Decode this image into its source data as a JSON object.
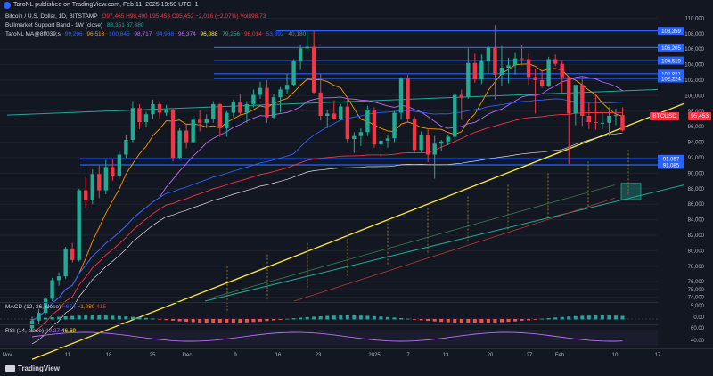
{
  "header": {
    "publisher": "TaroNL published on TradingView.com, Feb 11, 2025 19:50 UTC+1"
  },
  "legend": {
    "symbol_line": "Bitcoin / U.S. Dollar, 1D, BITSTAMP",
    "ohlc": "O97,465 H98,490 L95,453 C95,452 −2,016 (−2.07%) Vol898.73",
    "bull_band": "Bullmarket Support Band - 1W (close)",
    "bull_band_values": "88,351  87,380",
    "ma_line": "TaroNL MA@8ff039;s",
    "ma_values": [
      "99,296",
      "96,513",
      "100,845",
      "98,717",
      "94,938",
      "96,374",
      "96,088",
      "79,256",
      "98,014",
      "53,892",
      "40,180"
    ]
  },
  "macd_legend": {
    "label": "MACD (12, 26, close)",
    "values": [
      "−674",
      "−1,089",
      "415"
    ]
  },
  "rsi_legend": {
    "label": "RSI (14, close)",
    "values": [
      "40.27",
      "46.69"
    ]
  },
  "footer": {
    "logo_text": "TradingView"
  },
  "badges": {
    "last_price": "95,453",
    "symbol_tag": "BTCUSD"
  },
  "colors": {
    "background": "#131722",
    "up": "#22ab94",
    "down": "#f23645",
    "blue_level": "#2962ff",
    "trendline": "#ffeb3b",
    "channel": "#22ab94"
  },
  "chart_data": {
    "type": "candlestick",
    "x_ticks": [
      "Nov",
      "11",
      "18",
      "25",
      "Dec",
      "9",
      "16",
      "23",
      "2025",
      "7",
      "13",
      "20",
      "27",
      "Feb",
      "10",
      "17"
    ],
    "y_ticks": [
      110000,
      108000,
      106000,
      104000,
      102000,
      100000,
      98000,
      96000,
      94000,
      92000,
      90000,
      88000,
      86000,
      84000,
      82000,
      80000,
      78000,
      76000,
      75000,
      74000
    ],
    "y_tick_labels": [
      "110,000",
      "108,000",
      "106,000",
      "104,000",
      "102,000",
      "100,000",
      "98,000",
      "96,000",
      "94,000",
      "92,000",
      "90,000",
      "88,000",
      "86,000",
      "84,000",
      "82,000",
      "80,000",
      "78,000",
      "76,000",
      "75,000",
      "74,000"
    ],
    "horizontal_levels": [
      {
        "price": 108359,
        "label": "108,359"
      },
      {
        "price": 106205,
        "label": "106,205"
      },
      {
        "price": 104519,
        "label": "104,519"
      },
      {
        "price": 102821,
        "label": "102,821"
      },
      {
        "price": 102224,
        "label": "102,224"
      },
      {
        "price": 91857,
        "label": "91,857"
      },
      {
        "price": 91085,
        "label": "91,085"
      }
    ],
    "candles": [
      [
        70000,
        71500,
        69500,
        71000
      ],
      [
        71000,
        72500,
        70500,
        72000
      ],
      [
        72000,
        74000,
        71800,
        73800
      ],
      [
        73800,
        76500,
        73500,
        76200
      ],
      [
        76200,
        77200,
        75500,
        76700
      ],
      [
        76700,
        80500,
        76400,
        80300
      ],
      [
        80300,
        81000,
        78500,
        78800
      ],
      [
        78800,
        88000,
        78600,
        87800
      ],
      [
        87800,
        89500,
        85500,
        86500
      ],
      [
        86500,
        90500,
        86000,
        89900
      ],
      [
        89900,
        91000,
        86800,
        87800
      ],
      [
        87800,
        91700,
        87300,
        90800
      ],
      [
        90800,
        91800,
        89000,
        89700
      ],
      [
        89700,
        92800,
        89300,
        92400
      ],
      [
        92400,
        94900,
        92000,
        94300
      ],
      [
        94300,
        99300,
        94000,
        98400
      ],
      [
        98400,
        98900,
        95700,
        96600
      ],
      [
        96600,
        97900,
        96000,
        97600
      ],
      [
        97600,
        99500,
        97000,
        98900
      ],
      [
        98900,
        99300,
        97000,
        97800
      ],
      [
        97800,
        98800,
        97400,
        98100
      ],
      [
        98100,
        98300,
        91500,
        92000
      ],
      [
        92000,
        95800,
        91800,
        95500
      ],
      [
        95500,
        96400,
        93200,
        94000
      ],
      [
        94000,
        97400,
        93800,
        96900
      ],
      [
        96900,
        98100,
        95400,
        96500
      ],
      [
        96500,
        97600,
        95800,
        97000
      ],
      [
        97000,
        99300,
        96500,
        98900
      ],
      [
        98900,
        99000,
        94700,
        95800
      ],
      [
        95800,
        98000,
        94700,
        97800
      ],
      [
        97800,
        99500,
        97200,
        99200
      ],
      [
        99200,
        100300,
        97400,
        97800
      ],
      [
        97800,
        99300,
        96500,
        98900
      ],
      [
        98900,
        100800,
        98500,
        100100
      ],
      [
        100100,
        101800,
        99600,
        101000
      ],
      [
        101000,
        102000,
        96500,
        97200
      ],
      [
        97200,
        100200,
        96900,
        99800
      ],
      [
        99800,
        101100,
        97800,
        100800
      ],
      [
        100800,
        102800,
        100200,
        101400
      ],
      [
        101400,
        104700,
        101200,
        104400
      ],
      [
        104400,
        106500,
        103300,
        106100
      ],
      [
        106100,
        108300,
        105700,
        106300
      ],
      [
        106300,
        108400,
        100200,
        100400
      ],
      [
        100400,
        102800,
        96800,
        97400
      ],
      [
        97400,
        98200,
        95800,
        97700
      ],
      [
        97700,
        99400,
        96900,
        97000
      ],
      [
        97000,
        98900,
        96800,
        98600
      ],
      [
        98600,
        99800,
        94000,
        94400
      ],
      [
        94400,
        95300,
        92600,
        94800
      ],
      [
        94800,
        95800,
        93500,
        95300
      ],
      [
        95300,
        98700,
        94800,
        98200
      ],
      [
        98200,
        98500,
        93300,
        93700
      ],
      [
        93700,
        95000,
        92200,
        94200
      ],
      [
        94200,
        95000,
        93300,
        94500
      ],
      [
        94500,
        98000,
        94000,
        97800
      ],
      [
        97800,
        102400,
        96900,
        102200
      ],
      [
        102200,
        102700,
        96500,
        97000
      ],
      [
        97000,
        97300,
        92600,
        93000
      ],
      [
        93000,
        95400,
        92700,
        94900
      ],
      [
        94900,
        95700,
        91400,
        92400
      ],
      [
        92400,
        94800,
        89300,
        93800
      ],
      [
        93800,
        94300,
        92800,
        94100
      ],
      [
        94100,
        95000,
        93600,
        94700
      ],
      [
        94700,
        100300,
        94400,
        100100
      ],
      [
        100100,
        100800,
        96900,
        99800
      ],
      [
        99800,
        106100,
        99600,
        104200
      ],
      [
        104200,
        105400,
        101700,
        102100
      ],
      [
        102100,
        105300,
        101500,
        104400
      ],
      [
        104400,
        106400,
        102800,
        106200
      ],
      [
        106200,
        109100,
        99500,
        102700
      ],
      [
        102700,
        106400,
        101300,
        103600
      ],
      [
        103600,
        104900,
        101600,
        103900
      ],
      [
        103900,
        105600,
        102700,
        104800
      ],
      [
        104800,
        106500,
        103900,
        104700
      ],
      [
        104700,
        105400,
        101400,
        102400
      ],
      [
        102400,
        103500,
        97700,
        102000
      ],
      [
        102000,
        103200,
        101000,
        101300
      ],
      [
        101300,
        105000,
        101100,
        104700
      ],
      [
        104700,
        105300,
        103800,
        104100
      ],
      [
        104100,
        104600,
        100400,
        102400
      ],
      [
        102400,
        102500,
        91200,
        97700
      ],
      [
        97700,
        101200,
        96200,
        101400
      ],
      [
        101400,
        102500,
        96100,
        97400
      ],
      [
        97400,
        99200,
        95700,
        96600
      ],
      [
        96600,
        100100,
        95600,
        96500
      ],
      [
        96500,
        97800,
        95700,
        96500
      ],
      [
        96500,
        98500,
        94800,
        97400
      ],
      [
        97400,
        98300,
        96200,
        97500
      ],
      [
        97500,
        98500,
        95400,
        95500
      ]
    ],
    "trendline_start": [
      0,
      66000
    ],
    "trendline_end": [
      99,
      99000
    ]
  }
}
